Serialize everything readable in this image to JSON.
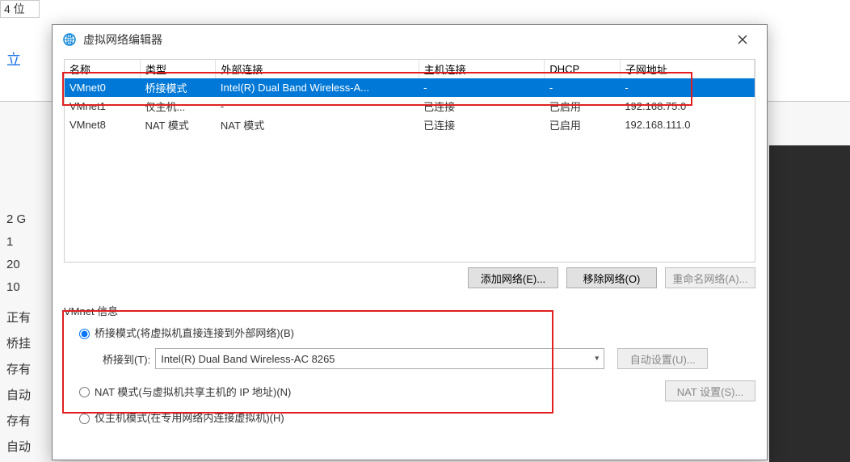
{
  "behind": {
    "strip": "4 位",
    "linkish": "立",
    "lines": [
      "2 G",
      "1",
      "20",
      "10",
      "正有",
      "桥挂",
      "存有",
      "自动",
      "存有",
      "自动"
    ]
  },
  "dialog": {
    "title": "虚拟网络编辑器"
  },
  "table": {
    "headers": {
      "name": "名称",
      "type": "类型",
      "ext": "外部连接",
      "host": "主机连接",
      "dhcp": "DHCP",
      "subnet": "子网地址"
    },
    "rows": [
      {
        "name": "VMnet0",
        "type": "桥接模式",
        "ext": "Intel(R) Dual Band Wireless-A...",
        "host": "-",
        "dhcp": "-",
        "subnet": "-",
        "selected": true
      },
      {
        "name": "VMnet1",
        "type": "仅主机...",
        "ext": "-",
        "host": "已连接",
        "dhcp": "已启用",
        "subnet": "192.168.75.0",
        "selected": false
      },
      {
        "name": "VMnet8",
        "type": "NAT 模式",
        "ext": "NAT 模式",
        "host": "已连接",
        "dhcp": "已启用",
        "subnet": "192.168.111.0",
        "selected": false
      }
    ]
  },
  "buttons": {
    "add": "添加网络(E)...",
    "remove": "移除网络(O)",
    "rename": "重命名网络(A)..."
  },
  "info": {
    "legend": "VMnet 信息",
    "radio_bridge": "桥接模式(将虚拟机直接连接到外部网络)(B)",
    "bridge_label": "桥接到(T):",
    "bridge_value": "Intel(R) Dual Band Wireless-AC 8265",
    "auto_btn": "自动设置(U)...",
    "radio_nat": "NAT 模式(与虚拟机共享主机的 IP 地址)(N)",
    "nat_btn": "NAT 设置(S)...",
    "radio_hostonly": "仅主机模式(在专用网络内连接虚拟机)(H)"
  }
}
